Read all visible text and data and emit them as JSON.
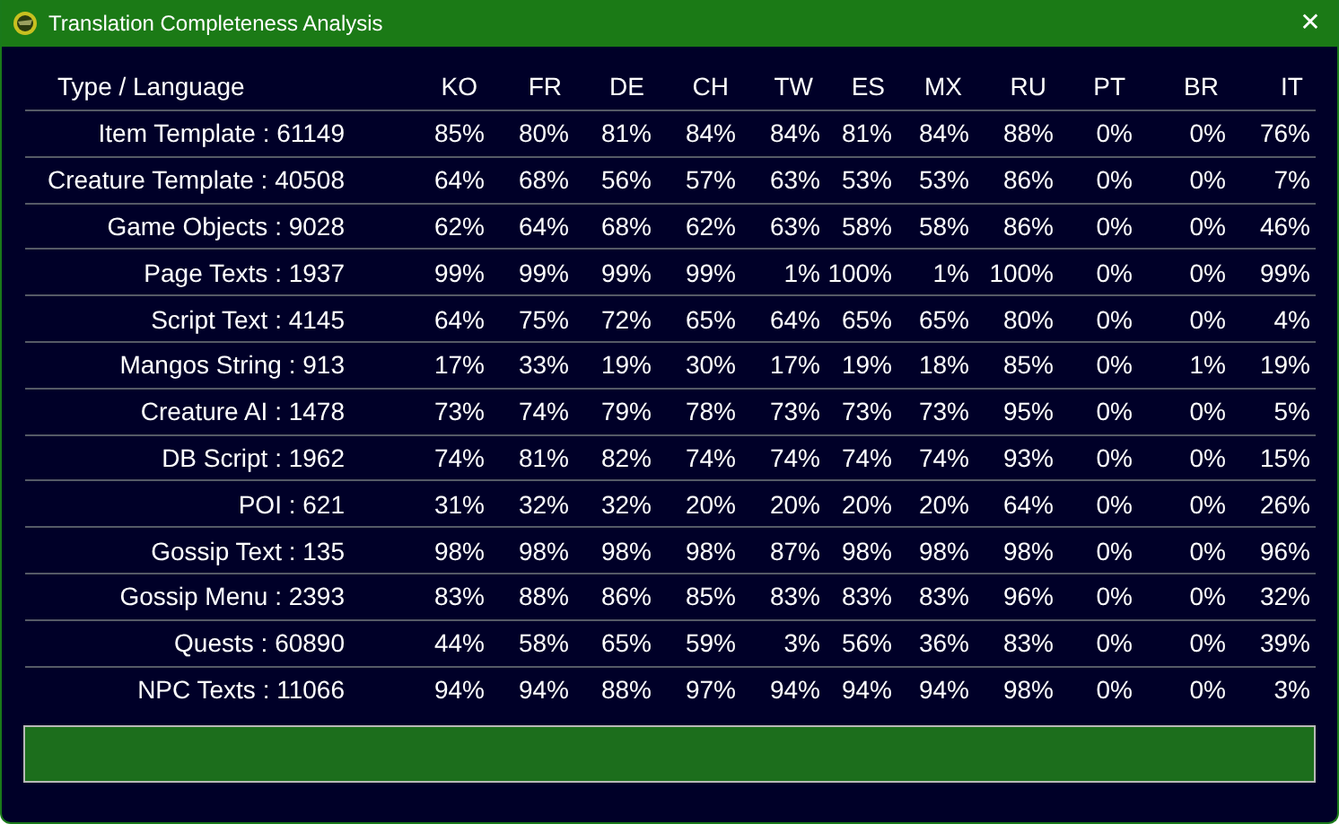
{
  "window": {
    "title": "Translation Completeness Analysis",
    "close": "✕"
  },
  "table": {
    "columns": [
      "Type / Language",
      "KO",
      "FR",
      "DE",
      "CH",
      "TW",
      "ES",
      "MX",
      "RU",
      "PT",
      "BR",
      "IT"
    ],
    "rows": [
      [
        "Item Template : 61149",
        "85%",
        "80%",
        "81%",
        "84%",
        "84%",
        "81%",
        "84%",
        "88%",
        "0%",
        "0%",
        "76%"
      ],
      [
        "Creature Template : 40508",
        "64%",
        "68%",
        "56%",
        "57%",
        "63%",
        "53%",
        "53%",
        "86%",
        "0%",
        "0%",
        "7%"
      ],
      [
        "Game Objects : 9028",
        "62%",
        "64%",
        "68%",
        "62%",
        "63%",
        "58%",
        "58%",
        "86%",
        "0%",
        "0%",
        "46%"
      ],
      [
        "Page Texts : 1937",
        "99%",
        "99%",
        "99%",
        "99%",
        "1%",
        "100%",
        "1%",
        "100%",
        "0%",
        "0%",
        "99%"
      ],
      [
        "Script Text : 4145",
        "64%",
        "75%",
        "72%",
        "65%",
        "64%",
        "65%",
        "65%",
        "80%",
        "0%",
        "0%",
        "4%"
      ],
      [
        "Mangos String : 913",
        "17%",
        "33%",
        "19%",
        "30%",
        "17%",
        "19%",
        "18%",
        "85%",
        "0%",
        "1%",
        "19%"
      ],
      [
        "Creature AI : 1478",
        "73%",
        "74%",
        "79%",
        "78%",
        "73%",
        "73%",
        "73%",
        "95%",
        "0%",
        "0%",
        "5%"
      ],
      [
        "DB Script : 1962",
        "74%",
        "81%",
        "82%",
        "74%",
        "74%",
        "74%",
        "74%",
        "93%",
        "0%",
        "0%",
        "15%"
      ],
      [
        "POI : 621",
        "31%",
        "32%",
        "32%",
        "20%",
        "20%",
        "20%",
        "20%",
        "64%",
        "0%",
        "0%",
        "26%"
      ],
      [
        "Gossip Text : 135",
        "98%",
        "98%",
        "98%",
        "98%",
        "87%",
        "98%",
        "98%",
        "98%",
        "0%",
        "0%",
        "96%"
      ],
      [
        "Gossip Menu : 2393",
        "83%",
        "88%",
        "86%",
        "85%",
        "83%",
        "83%",
        "83%",
        "96%",
        "0%",
        "0%",
        "32%"
      ],
      [
        "Quests : 60890",
        "44%",
        "58%",
        "65%",
        "59%",
        "3%",
        "56%",
        "36%",
        "83%",
        "0%",
        "0%",
        "39%"
      ],
      [
        "NPC Texts : 11066",
        "94%",
        "94%",
        "88%",
        "97%",
        "94%",
        "94%",
        "94%",
        "98%",
        "0%",
        "0%",
        "3%"
      ]
    ]
  },
  "progress": {
    "level": 1
  }
}
